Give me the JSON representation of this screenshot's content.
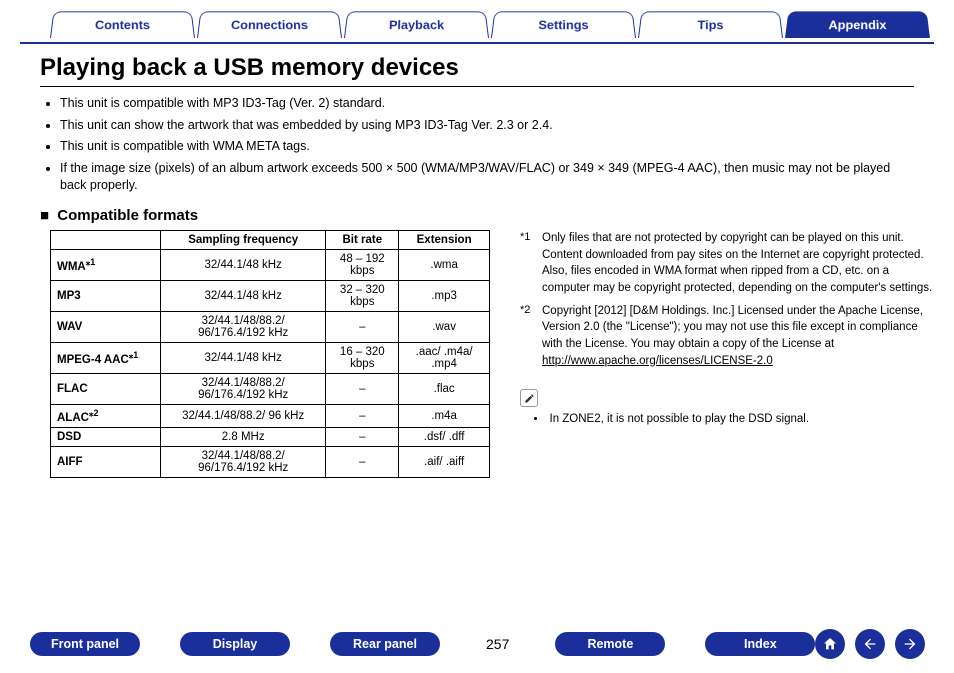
{
  "tabs": {
    "items": [
      "Contents",
      "Connections",
      "Playback",
      "Settings",
      "Tips",
      "Appendix"
    ],
    "activeIndex": 5
  },
  "title": "Playing back a USB memory devices",
  "bullets": [
    "This unit is compatible with MP3 ID3-Tag (Ver. 2) standard.",
    "This unit can show the artwork that was embedded by using MP3 ID3-Tag Ver. 2.3 or 2.4.",
    "This unit is compatible with WMA META tags.",
    "If the image size (pixels) of an album artwork exceeds 500 × 500 (WMA/MP3/WAV/FLAC) or 349 × 349 (MPEG-4 AAC), then music may not be played back properly."
  ],
  "section_title": "Compatible formats",
  "table": {
    "headers": [
      "",
      "Sampling frequency",
      "Bit rate",
      "Extension"
    ],
    "rows": [
      {
        "name": "WMA",
        "sup": "*1",
        "freq": "32/44.1/48 kHz",
        "rate": "48 – 192 kbps",
        "ext": ".wma"
      },
      {
        "name": "MP3",
        "sup": "",
        "freq": "32/44.1/48 kHz",
        "rate": "32 – 320 kbps",
        "ext": ".mp3"
      },
      {
        "name": "WAV",
        "sup": "",
        "freq": "32/44.1/48/88.2/ 96/176.4/192 kHz",
        "rate": "–",
        "ext": ".wav"
      },
      {
        "name": "MPEG-4 AAC",
        "sup": "*1",
        "freq": "32/44.1/48 kHz",
        "rate": "16 – 320 kbps",
        "ext": ".aac/ .m4a/ .mp4"
      },
      {
        "name": "FLAC",
        "sup": "",
        "freq": "32/44.1/48/88.2/ 96/176.4/192 kHz",
        "rate": "–",
        "ext": ".flac"
      },
      {
        "name": "ALAC",
        "sup": "*2",
        "freq": "32/44.1/48/88.2/ 96 kHz",
        "rate": "–",
        "ext": ".m4a"
      },
      {
        "name": "DSD",
        "sup": "",
        "freq": "2.8 MHz",
        "rate": "–",
        "ext": ".dsf/ .dff"
      },
      {
        "name": "AIFF",
        "sup": "",
        "freq": "32/44.1/48/88.2/ 96/176.4/192 kHz",
        "rate": "–",
        "ext": ".aif/ .aiff"
      }
    ]
  },
  "footnotes": [
    {
      "mark": "*1",
      "text": "Only files that are not protected by copyright can be played on this unit. Content downloaded from pay sites on the Internet are copyright protected. Also, files encoded in WMA format when ripped from a CD, etc. on a computer may be copyright protected, depending on the computer's settings."
    },
    {
      "mark": "*2",
      "text": "Copyright [2012] [D&M Holdings. Inc.] Licensed under the Apache License, Version 2.0 (the \"License\"); you may not use this file except in compliance with the License. You may obtain a copy of the License at",
      "link": "http://www.apache.org/licenses/LICENSE-2.0"
    }
  ],
  "zone_note": "In ZONE2, it is not possible to play the DSD signal.",
  "bottom": {
    "left_pills": [
      "Front panel",
      "Display",
      "Rear panel"
    ],
    "page_num": "257",
    "right_pills": [
      "Remote",
      "Index"
    ]
  }
}
